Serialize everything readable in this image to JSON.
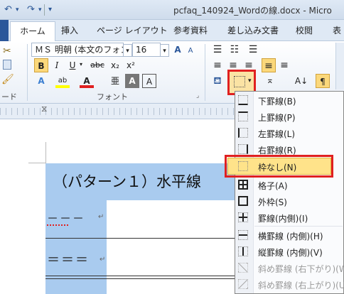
{
  "window": {
    "title": "pcfaq_140924_Wordの線.docx - Micro"
  },
  "tabs": [
    {
      "label": "ホーム"
    },
    {
      "label": "挿入"
    },
    {
      "label": "ページ レイアウト"
    },
    {
      "label": "参考資料"
    },
    {
      "label": "差し込み文書"
    },
    {
      "label": "校閲"
    },
    {
      "label": "表"
    }
  ],
  "ribbon": {
    "font_name": "ＭＳ 明朝 (本文のフォン",
    "font_size": "16",
    "clipboard_label": "ード",
    "font_group_label": "フォント",
    "buttons": {
      "bold": "B",
      "italic": "I",
      "underline": "U",
      "strike": "abc",
      "subscript": "x₂",
      "superscript": "x²",
      "grow": "A",
      "shrink": "A",
      "clear": "A",
      "highlight": "ab",
      "fontcolor": "A",
      "phonetic": "亜",
      "enclose": "A",
      "charborder": "A",
      "sort": "A↓"
    }
  },
  "document": {
    "heading": "（パターン１）水平線",
    "line1": "－－－",
    "line2": "＝＝＝",
    "para_mark": "↵"
  },
  "border_menu": {
    "items": [
      {
        "label": "下罫線(B)",
        "icon": "border-bottom-icon"
      },
      {
        "label": "上罫線(P)",
        "icon": "border-top-icon"
      },
      {
        "label": "左罫線(L)",
        "icon": "border-left-icon"
      },
      {
        "label": "右罫線(R)",
        "icon": "border-right-icon"
      },
      {
        "label": "枠なし(N)",
        "icon": "no-border-icon"
      },
      {
        "label": "格子(A)",
        "icon": "all-borders-icon"
      },
      {
        "label": "外枠(S)",
        "icon": "outside-borders-icon"
      },
      {
        "label": "罫線(内側)(I)",
        "icon": "inside-borders-icon"
      },
      {
        "label": "横罫線 (内側)(H)",
        "icon": "inside-horizontal-icon"
      },
      {
        "label": "縦罫線 (内側)(V)",
        "icon": "inside-vertical-icon"
      },
      {
        "label": "斜め罫線 (右下がり)(W)",
        "icon": "diagonal-down-icon"
      },
      {
        "label": "斜め罫線 (右上がり)(U)",
        "icon": "diagonal-up-icon"
      }
    ]
  },
  "colors": {
    "accent": "#2b579a",
    "highlight_red": "#e02020",
    "selection": "#a9cbef",
    "hover": "#ffe38a"
  }
}
